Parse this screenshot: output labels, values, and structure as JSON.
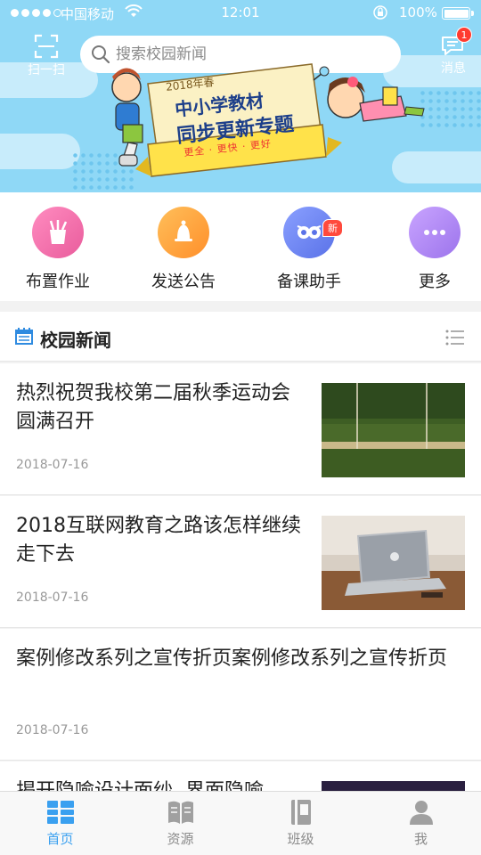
{
  "status_bar": {
    "carrier": "中国移动",
    "time": "12:01",
    "battery": "100%"
  },
  "header": {
    "scan_label": "扫一扫",
    "search_placeholder": "搜索校园新闻",
    "message_label": "消息",
    "message_badge": "1"
  },
  "banner": {
    "season": "2018年春",
    "line1": "中小学教材",
    "line2": "同步更新专题",
    "tagline": "更全 · 更快 · 更好"
  },
  "quick_actions": [
    {
      "label": "布置作业",
      "icon": "pencil-cup-icon",
      "color": "#f06aa8"
    },
    {
      "label": "发送公告",
      "icon": "bell-icon",
      "color": "#ffa23a"
    },
    {
      "label": "备课助手",
      "icon": "owl-icon",
      "color": "#6f86f2",
      "badge": "新"
    },
    {
      "label": "更多",
      "icon": "more-dots-icon",
      "color": "#b58bf0"
    }
  ],
  "news_section": {
    "title": "校园新闻"
  },
  "news": [
    {
      "title": "热烈祝贺我校第二届秋季运动会圆满召开",
      "date": "2018-07-16",
      "thumb": "sports-field-image"
    },
    {
      "title": "2018互联网教育之路该怎样继续走下去",
      "date": "2018-07-16",
      "thumb": "laptop-desk-image"
    },
    {
      "title": "案例修改系列之宣传折页案例修改系列之宣传折页",
      "date": "2018-07-16",
      "thumb": ""
    },
    {
      "title": "揭开隐喻设计面纱, 界面隐喻",
      "date": "",
      "thumb": "dark-image"
    }
  ],
  "tabs": [
    {
      "label": "首页",
      "icon": "home-grid-icon",
      "active": true
    },
    {
      "label": "资源",
      "icon": "book-icon",
      "active": false
    },
    {
      "label": "班级",
      "icon": "notebook-icon",
      "active": false
    },
    {
      "label": "我",
      "icon": "person-icon",
      "active": false
    }
  ],
  "colors": {
    "header_bg": "#8fd8f6",
    "accent": "#3aa0f0",
    "badge_red": "#ff3b30"
  }
}
